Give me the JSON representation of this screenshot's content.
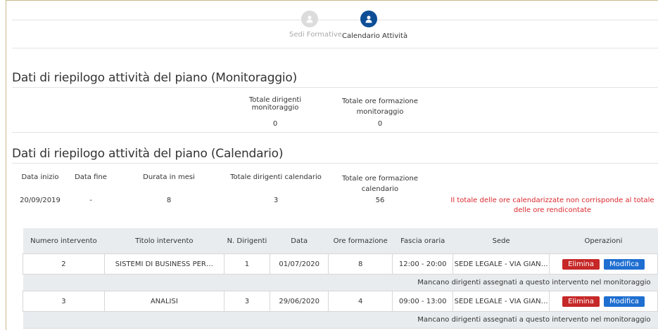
{
  "steps": [
    {
      "label": "Sedi Formative",
      "active": false,
      "icon": "user-icon"
    },
    {
      "label": "Calendario Attività",
      "active": true,
      "icon": "user-icon"
    }
  ],
  "monitoraggio": {
    "title": "Dati di riepilogo attività del piano (Monitoraggio)",
    "col_dirigenti": "Totale dirigenti monitoraggio",
    "col_ore": "Totale ore formazione monitoraggio",
    "val_dirigenti": "0",
    "val_ore": "0"
  },
  "calendario": {
    "title": "Dati di riepilogo attività del piano (Calendario)",
    "headers": {
      "data_inizio": "Data inizio",
      "data_fine": "Data fine",
      "durata": "Durata in mesi",
      "dirigenti": "Totale dirigenti calendario",
      "ore": "Totale ore formazione calendario"
    },
    "values": {
      "data_inizio": "20/09/2019",
      "data_fine": "-",
      "durata": "8",
      "dirigenti": "3",
      "ore": "56"
    },
    "error": "Il totale delle ore calendarizzate non corrisponde al totale delle ore rendicontate"
  },
  "table": {
    "columns": [
      "Numero intervento",
      "Titolo intervento",
      "N. Dirigenti",
      "Data",
      "Ore formazione",
      "Fascia oraria",
      "Sede",
      "Operazioni"
    ],
    "rows": [
      {
        "numero": "2",
        "titolo": "SISTEMI DI BUSINESS PER…",
        "dirigenti": "1",
        "data": "01/07/2020",
        "ore": "8",
        "fascia": "12:00 - 20:00",
        "sede": "SEDE LEGALE - VIA GIAN…",
        "note": "Mancano dirigenti assegnati a questo intervento nel monitoraggio"
      },
      {
        "numero": "3",
        "titolo": "ANALISI",
        "dirigenti": "3",
        "data": "29/06/2020",
        "ore": "4",
        "fascia": "09:00 - 13:00",
        "sede": "SEDE LEGALE - VIA GIAN…",
        "note": "Mancano dirigenti assegnati a questo intervento nel monitoraggio"
      }
    ],
    "delete_label": "Elimina",
    "edit_label": "Modifica"
  },
  "colors": {
    "accent": "#0d4e96",
    "error": "#d9282f",
    "delete": "#c62828",
    "edit": "#1f6fd1"
  }
}
